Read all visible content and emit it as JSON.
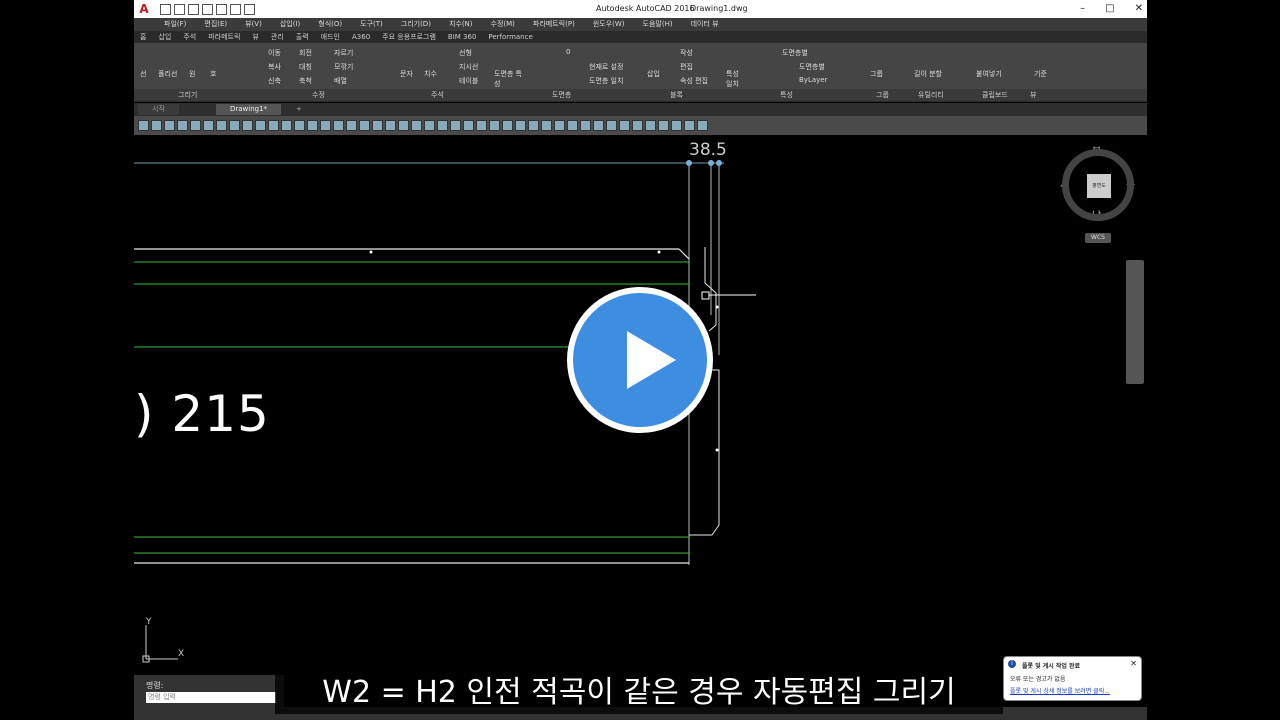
{
  "titlebar": {
    "app_title": "Autodesk AutoCAD 2016",
    "file_name": "Drawing1.dwg",
    "logo": "A"
  },
  "menu": [
    "파일(F)",
    "편집(E)",
    "뷰(V)",
    "삽입(I)",
    "형식(O)",
    "도구(T)",
    "그리기(D)",
    "치수(N)",
    "수정(M)",
    "파라메트릭(P)",
    "윈도우(W)",
    "도움말(H)",
    "데이터 뷰"
  ],
  "ribbon_tabs": [
    "홈",
    "삽입",
    "주석",
    "파라메트릭",
    "뷰",
    "관리",
    "출력",
    "애드인",
    "A360",
    "주요 응용프로그램",
    "BIM 360",
    "Performance"
  ],
  "ribbon": {
    "draw": {
      "line": "선",
      "polyline": "폴리선",
      "circle": "원",
      "arc": "호"
    },
    "modify": {
      "move": "이동",
      "rotate": "회전",
      "trim": "자르기",
      "copy": "복사",
      "mirror": "대칭",
      "fillet": "모깎기",
      "stretch": "신축",
      "scale": "축척",
      "array": "배열"
    },
    "annotation": {
      "text": "문자",
      "dimension": "치수",
      "linear": "선형",
      "leader": "지시선",
      "table": "테이블"
    },
    "layers": {
      "layer_properties": "도면층 특성",
      "current_layer": "0",
      "make_current": "현재로 설정",
      "match_layer": "도면층 일치"
    },
    "block": {
      "insert": "삽입",
      "create": "작성",
      "edit": "편집",
      "edit_attributes": "속성 편집"
    },
    "properties": {
      "match": "특성 일치",
      "color": "도면층별",
      "linetype": "도면층별",
      "lineweight": "ByLayer"
    },
    "groups": {
      "group": "그룹"
    },
    "utilities": {
      "measure": "길이 분할"
    },
    "clipboard": {
      "paste": "붙여넣기"
    },
    "view": {
      "base": "기준"
    }
  },
  "panel_labels": [
    "그리기",
    "수정",
    "주석",
    "도면층",
    "블록",
    "특성",
    "그룹",
    "유틸리티",
    "클립보드",
    "뷰"
  ],
  "doc_tabs": {
    "start": "시작",
    "active": "Drawing1*",
    "plus": "+"
  },
  "canvas": {
    "dimension_text": "38.5",
    "big_label": ") 215",
    "ucs_y": "Y",
    "ucs_x": "X"
  },
  "navcube": {
    "north": "북",
    "south": "남",
    "west": "서",
    "east": "동",
    "face": "평면도",
    "wcs": "WCS"
  },
  "command": {
    "label": "명령:",
    "placeholder": "명령 입력"
  },
  "notification": {
    "title": "플롯 및 게시 작업 완료",
    "message": "오류 또는 경고가 없음",
    "link": "플롯 및 게시 상세 정보를 보려면 클릭..."
  },
  "subtitle": "W2 = H2 인전 적곡이 같은 경우 자동편집 그리기",
  "colors": {
    "accent_play": "#3d8de0",
    "cad_green": "#3cb83c",
    "cad_white": "#e8e8e8"
  }
}
